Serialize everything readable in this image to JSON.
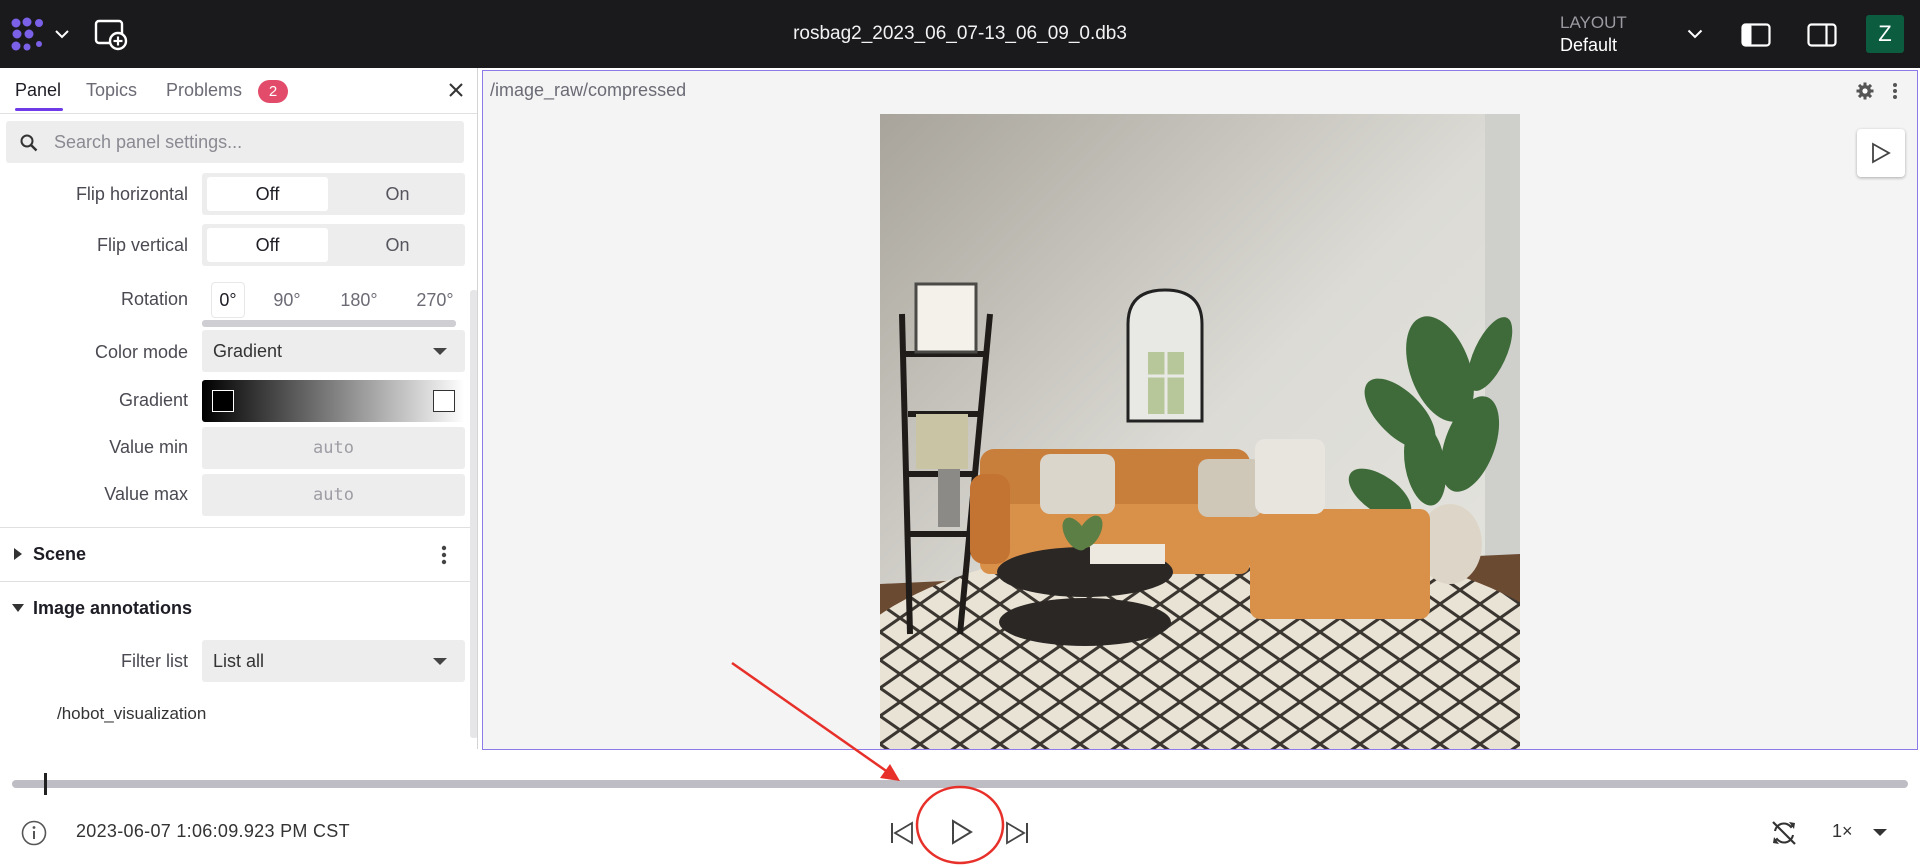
{
  "topbar": {
    "file_title": "rosbag2_2023_06_07-13_06_09_0.db3",
    "layout_label": "LAYOUT",
    "layout_value": "Default",
    "avatar_initial": "Z"
  },
  "sidebar": {
    "tabs": [
      {
        "label": "Panel"
      },
      {
        "label": "Topics"
      },
      {
        "label": "Problems"
      }
    ],
    "problems_count": "2",
    "search_placeholder": "Search panel settings...",
    "flip_horizontal": {
      "label": "Flip horizontal",
      "options": [
        "Off",
        "On"
      ],
      "selected": "Off"
    },
    "flip_vertical": {
      "label": "Flip vertical",
      "options": [
        "Off",
        "On"
      ],
      "selected": "Off"
    },
    "rotation": {
      "label": "Rotation",
      "options": [
        "0°",
        "90°",
        "180°",
        "270°"
      ],
      "selected": "0°"
    },
    "color_mode": {
      "label": "Color mode",
      "value": "Gradient"
    },
    "gradient": {
      "label": "Gradient",
      "min_color": "#000000",
      "max_color": "#ffffff"
    },
    "value_min": {
      "label": "Value min",
      "placeholder": "auto"
    },
    "value_max": {
      "label": "Value max",
      "placeholder": "auto"
    },
    "sections": {
      "scene": "Scene",
      "image_annotations": "Image annotations"
    },
    "filter_list": {
      "label": "Filter list",
      "value": "List all"
    },
    "annotation_topic": "/hobot_visualization"
  },
  "image_panel": {
    "topic": "/image_raw/compressed",
    "accent_color": "#8e79e8"
  },
  "playback": {
    "current_time": "2023-06-07 1:06:09.923 PM CST",
    "speed": "1×",
    "progress": 0.017
  },
  "colors": {
    "topbar_bg": "#1a1a1d",
    "accent": "#6f3be8",
    "badge": "#e34b6a",
    "avatar": "#0c5c40",
    "annotation": "#e8302a"
  },
  "icons": [
    "app-logo-icon",
    "chevron-down-icon",
    "add-panel-icon",
    "left-sidebar-toggle-icon",
    "right-sidebar-toggle-icon",
    "close-icon",
    "search-icon",
    "caret-down-icon",
    "caret-right-icon",
    "more-vertical-icon",
    "gear-icon",
    "publish-pointer-icon",
    "info-icon",
    "skip-back-icon",
    "play-icon",
    "skip-forward-icon",
    "loop-off-icon"
  ]
}
